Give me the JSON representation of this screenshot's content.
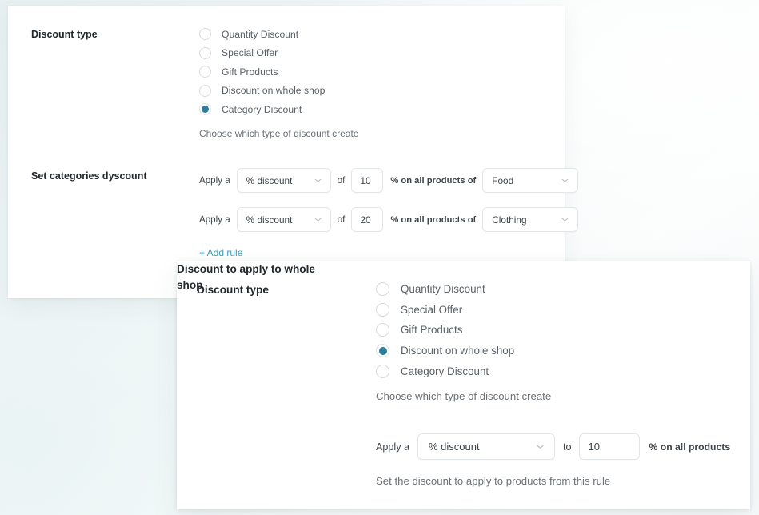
{
  "theme": {
    "accent_teal": "#2d7e99",
    "link_teal": "#3f9cb9",
    "label_color": "#22272b",
    "muted_text": "#6b7177",
    "card_bg": "#ffffff",
    "page_bg": "#eef4f5"
  },
  "top_card": {
    "discount_type": {
      "label": "Discount type",
      "options": [
        {
          "label": "Quantity Discount",
          "selected": false
        },
        {
          "label": "Special Offer",
          "selected": false
        },
        {
          "label": "Gift Products",
          "selected": false
        },
        {
          "label": "Discount on whole shop",
          "selected": false
        },
        {
          "label": "Category Discount",
          "selected": true
        }
      ],
      "helper": "Choose which type of discount create"
    },
    "set_categories": {
      "label": "Set categories dyscount",
      "rules": [
        {
          "lead_text": "Apply a",
          "type_value": "% discount",
          "mid_text": "of",
          "amount": "10",
          "suffix_text": "% on all products of",
          "category_value": "Food"
        },
        {
          "lead_text": "Apply a",
          "type_value": "% discount",
          "mid_text": "of",
          "amount": "20",
          "suffix_text": "% on all products of",
          "category_value": "Clothing"
        }
      ],
      "add_rule_label": "+ Add rule"
    }
  },
  "bottom_card": {
    "discount_type": {
      "label": "Discount type",
      "options": [
        {
          "label": "Quantity Discount",
          "selected": false
        },
        {
          "label": "Special Offer",
          "selected": false
        },
        {
          "label": "Gift Products",
          "selected": false
        },
        {
          "label": "Discount on whole shop",
          "selected": true
        },
        {
          "label": "Category Discount",
          "selected": false
        }
      ],
      "helper": "Choose which type of discount create"
    },
    "whole_shop": {
      "label": "Discount to apply to whole shop",
      "rule": {
        "lead_text": "Apply a",
        "type_value": "% discount",
        "mid_text": "to",
        "amount": "10",
        "suffix_text": "% on all products"
      },
      "helper": "Set the discount to apply to products from this rule"
    }
  },
  "icons": {
    "chevron_down": "chevron-down-icon"
  }
}
